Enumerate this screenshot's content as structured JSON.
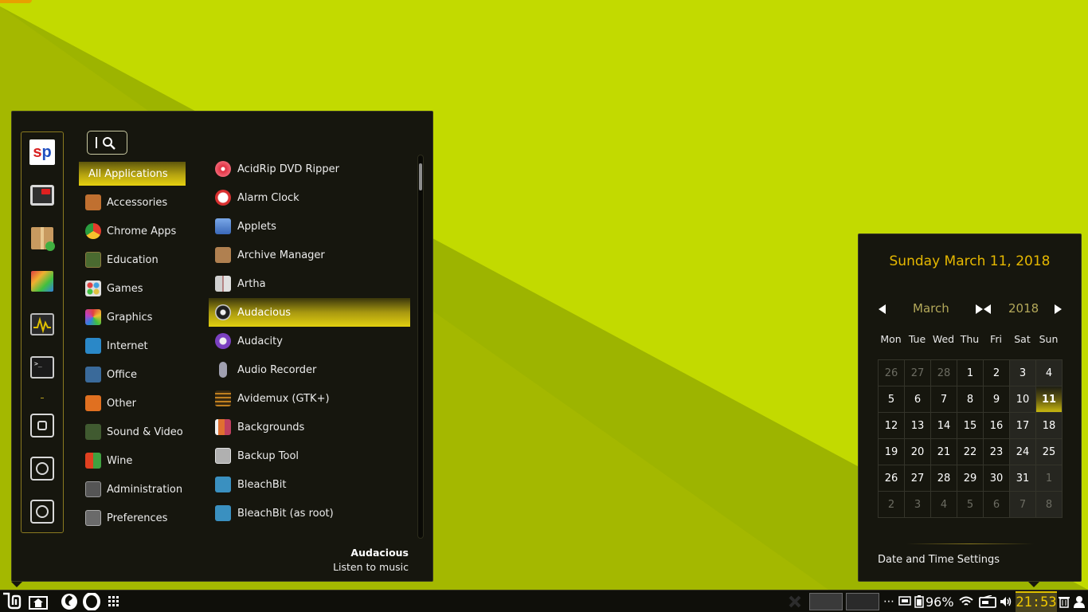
{
  "menu": {
    "categories": [
      {
        "label": "All Applications",
        "icon": "all-apps",
        "color": ""
      },
      {
        "label": "Accessories",
        "icon": "accessories-icon",
        "color": "#c07030"
      },
      {
        "label": "Chrome Apps",
        "icon": "chrome-icon",
        "color": "#2a9d40"
      },
      {
        "label": "Education",
        "icon": "education-icon",
        "color": "#4a6a30"
      },
      {
        "label": "Games",
        "icon": "games-icon",
        "color": "#d8d8d8"
      },
      {
        "label": "Graphics",
        "icon": "graphics-icon",
        "color": "#e04080"
      },
      {
        "label": "Internet",
        "icon": "internet-icon",
        "color": "#2a88c8"
      },
      {
        "label": "Office",
        "icon": "office-icon",
        "color": "#3a6a9a"
      },
      {
        "label": "Other",
        "icon": "other-icon",
        "color": "#e07020"
      },
      {
        "label": "Sound & Video",
        "icon": "sound-video-icon",
        "color": "#40a040"
      },
      {
        "label": "Wine",
        "icon": "wine-icon",
        "color": "#d04020"
      },
      {
        "label": "Administration",
        "icon": "administration-icon",
        "color": "#666666"
      },
      {
        "label": "Preferences",
        "icon": "preferences-icon",
        "color": "#888888"
      }
    ],
    "apps": [
      {
        "label": "AcidRip DVD Ripper",
        "icon": "dvd-icon",
        "color": "#e03040"
      },
      {
        "label": "Alarm Clock",
        "icon": "alarm-clock-icon",
        "color": "#d83030"
      },
      {
        "label": "Applets",
        "icon": "applets-icon",
        "color": "#4a78c8"
      },
      {
        "label": "Archive Manager",
        "icon": "archive-icon",
        "color": "#b08050"
      },
      {
        "label": "Artha",
        "icon": "book-icon",
        "color": "#c0c0c0"
      },
      {
        "label": "Audacious",
        "icon": "audacious-icon",
        "color": "#202020"
      },
      {
        "label": "Audacity",
        "icon": "audacity-icon",
        "color": "#7a40c0"
      },
      {
        "label": "Audio Recorder",
        "icon": "microphone-icon",
        "color": "#a0a0b0"
      },
      {
        "label": "Avidemux (GTK+)",
        "icon": "film-icon",
        "color": "#c08020"
      },
      {
        "label": "Backgrounds",
        "icon": "backgrounds-icon",
        "color": "#e07030"
      },
      {
        "label": "Backup Tool",
        "icon": "backup-icon",
        "color": "#b0b0b0"
      },
      {
        "label": "BleachBit",
        "icon": "bleachbit-icon",
        "color": "#3a90c0"
      },
      {
        "label": "BleachBit (as root)",
        "icon": "bleachbit-icon",
        "color": "#3a90c0"
      }
    ],
    "selected_app_title": "Audacious",
    "selected_app_desc": "Listen to music"
  },
  "favorites": [
    {
      "icon": "sp-icon"
    },
    {
      "icon": "youtube-tv-icon"
    },
    {
      "icon": "package-icon"
    },
    {
      "icon": "color-icon"
    },
    {
      "icon": "system-monitor-icon"
    },
    {
      "icon": "terminal-icon"
    }
  ],
  "calendar": {
    "date": "Sunday March 11, 2018",
    "month": "March",
    "year": "2018",
    "weekdays": [
      "Mon",
      "Tue",
      "Wed",
      "Thu",
      "Fri",
      "Sat",
      "Sun"
    ],
    "days": [
      [
        "26",
        "27",
        "28",
        "1",
        "2",
        "3",
        "4"
      ],
      [
        "5",
        "6",
        "7",
        "8",
        "9",
        "10",
        "11"
      ],
      [
        "12",
        "13",
        "14",
        "15",
        "16",
        "17",
        "18"
      ],
      [
        "19",
        "20",
        "21",
        "22",
        "23",
        "24",
        "25"
      ],
      [
        "26",
        "27",
        "28",
        "29",
        "30",
        "31",
        "1"
      ],
      [
        "2",
        "3",
        "4",
        "5",
        "6",
        "7",
        "8"
      ]
    ],
    "today": "11",
    "settings_label": "Date and Time Settings"
  },
  "panel": {
    "battery": "96%",
    "clock": "21:53"
  },
  "colors": {
    "accent": "#e6b800",
    "wallpaper_light": "#c2da00",
    "wallpaper_dark": "#9ab000"
  }
}
